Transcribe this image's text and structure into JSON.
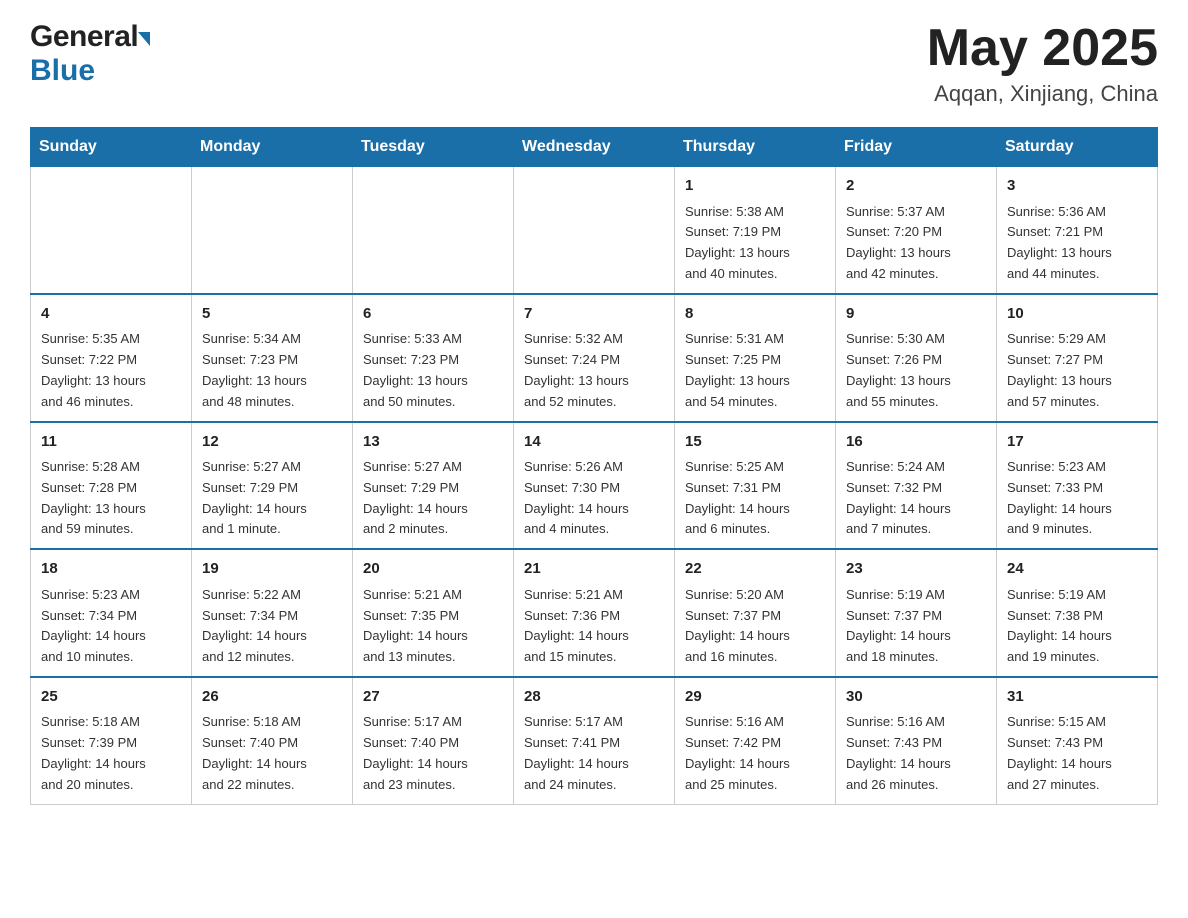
{
  "header": {
    "logo_general": "General",
    "logo_blue": "Blue",
    "title": "May 2025",
    "subtitle": "Aqqan, Xinjiang, China"
  },
  "days_of_week": [
    "Sunday",
    "Monday",
    "Tuesday",
    "Wednesday",
    "Thursday",
    "Friday",
    "Saturday"
  ],
  "weeks": [
    [
      {
        "day": "",
        "info": ""
      },
      {
        "day": "",
        "info": ""
      },
      {
        "day": "",
        "info": ""
      },
      {
        "day": "",
        "info": ""
      },
      {
        "day": "1",
        "info": "Sunrise: 5:38 AM\nSunset: 7:19 PM\nDaylight: 13 hours\nand 40 minutes."
      },
      {
        "day": "2",
        "info": "Sunrise: 5:37 AM\nSunset: 7:20 PM\nDaylight: 13 hours\nand 42 minutes."
      },
      {
        "day": "3",
        "info": "Sunrise: 5:36 AM\nSunset: 7:21 PM\nDaylight: 13 hours\nand 44 minutes."
      }
    ],
    [
      {
        "day": "4",
        "info": "Sunrise: 5:35 AM\nSunset: 7:22 PM\nDaylight: 13 hours\nand 46 minutes."
      },
      {
        "day": "5",
        "info": "Sunrise: 5:34 AM\nSunset: 7:23 PM\nDaylight: 13 hours\nand 48 minutes."
      },
      {
        "day": "6",
        "info": "Sunrise: 5:33 AM\nSunset: 7:23 PM\nDaylight: 13 hours\nand 50 minutes."
      },
      {
        "day": "7",
        "info": "Sunrise: 5:32 AM\nSunset: 7:24 PM\nDaylight: 13 hours\nand 52 minutes."
      },
      {
        "day": "8",
        "info": "Sunrise: 5:31 AM\nSunset: 7:25 PM\nDaylight: 13 hours\nand 54 minutes."
      },
      {
        "day": "9",
        "info": "Sunrise: 5:30 AM\nSunset: 7:26 PM\nDaylight: 13 hours\nand 55 minutes."
      },
      {
        "day": "10",
        "info": "Sunrise: 5:29 AM\nSunset: 7:27 PM\nDaylight: 13 hours\nand 57 minutes."
      }
    ],
    [
      {
        "day": "11",
        "info": "Sunrise: 5:28 AM\nSunset: 7:28 PM\nDaylight: 13 hours\nand 59 minutes."
      },
      {
        "day": "12",
        "info": "Sunrise: 5:27 AM\nSunset: 7:29 PM\nDaylight: 14 hours\nand 1 minute."
      },
      {
        "day": "13",
        "info": "Sunrise: 5:27 AM\nSunset: 7:29 PM\nDaylight: 14 hours\nand 2 minutes."
      },
      {
        "day": "14",
        "info": "Sunrise: 5:26 AM\nSunset: 7:30 PM\nDaylight: 14 hours\nand 4 minutes."
      },
      {
        "day": "15",
        "info": "Sunrise: 5:25 AM\nSunset: 7:31 PM\nDaylight: 14 hours\nand 6 minutes."
      },
      {
        "day": "16",
        "info": "Sunrise: 5:24 AM\nSunset: 7:32 PM\nDaylight: 14 hours\nand 7 minutes."
      },
      {
        "day": "17",
        "info": "Sunrise: 5:23 AM\nSunset: 7:33 PM\nDaylight: 14 hours\nand 9 minutes."
      }
    ],
    [
      {
        "day": "18",
        "info": "Sunrise: 5:23 AM\nSunset: 7:34 PM\nDaylight: 14 hours\nand 10 minutes."
      },
      {
        "day": "19",
        "info": "Sunrise: 5:22 AM\nSunset: 7:34 PM\nDaylight: 14 hours\nand 12 minutes."
      },
      {
        "day": "20",
        "info": "Sunrise: 5:21 AM\nSunset: 7:35 PM\nDaylight: 14 hours\nand 13 minutes."
      },
      {
        "day": "21",
        "info": "Sunrise: 5:21 AM\nSunset: 7:36 PM\nDaylight: 14 hours\nand 15 minutes."
      },
      {
        "day": "22",
        "info": "Sunrise: 5:20 AM\nSunset: 7:37 PM\nDaylight: 14 hours\nand 16 minutes."
      },
      {
        "day": "23",
        "info": "Sunrise: 5:19 AM\nSunset: 7:37 PM\nDaylight: 14 hours\nand 18 minutes."
      },
      {
        "day": "24",
        "info": "Sunrise: 5:19 AM\nSunset: 7:38 PM\nDaylight: 14 hours\nand 19 minutes."
      }
    ],
    [
      {
        "day": "25",
        "info": "Sunrise: 5:18 AM\nSunset: 7:39 PM\nDaylight: 14 hours\nand 20 minutes."
      },
      {
        "day": "26",
        "info": "Sunrise: 5:18 AM\nSunset: 7:40 PM\nDaylight: 14 hours\nand 22 minutes."
      },
      {
        "day": "27",
        "info": "Sunrise: 5:17 AM\nSunset: 7:40 PM\nDaylight: 14 hours\nand 23 minutes."
      },
      {
        "day": "28",
        "info": "Sunrise: 5:17 AM\nSunset: 7:41 PM\nDaylight: 14 hours\nand 24 minutes."
      },
      {
        "day": "29",
        "info": "Sunrise: 5:16 AM\nSunset: 7:42 PM\nDaylight: 14 hours\nand 25 minutes."
      },
      {
        "day": "30",
        "info": "Sunrise: 5:16 AM\nSunset: 7:43 PM\nDaylight: 14 hours\nand 26 minutes."
      },
      {
        "day": "31",
        "info": "Sunrise: 5:15 AM\nSunset: 7:43 PM\nDaylight: 14 hours\nand 27 minutes."
      }
    ]
  ]
}
